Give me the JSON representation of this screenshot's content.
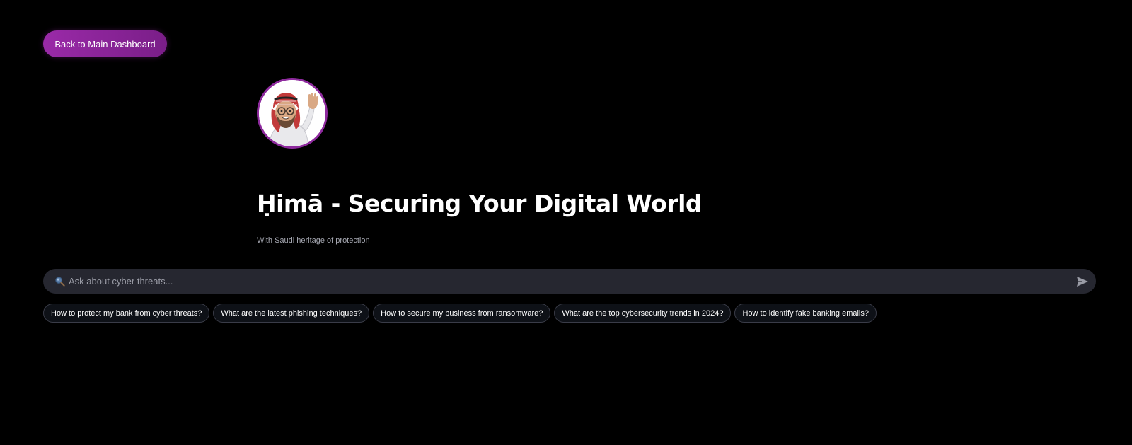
{
  "nav": {
    "back_label": "Back to Main Dashboard"
  },
  "header": {
    "avatar_icon": "waving-man-avatar-icon",
    "title": "Ḥimā - Securing Your Digital World",
    "subtitle": "With Saudi heritage of protection"
  },
  "chat": {
    "placeholder": "Ask about cyber threats...",
    "value": "",
    "search_icon": "search-icon",
    "send_icon": "send-icon"
  },
  "suggestions": [
    {
      "label": "How to protect my bank from cyber threats?"
    },
    {
      "label": "What are the latest phishing techniques?"
    },
    {
      "label": "How to secure my business from ransomware?"
    },
    {
      "label": "What are the top cybersecurity trends in 2024?"
    },
    {
      "label": "How to identify fake banking emails?"
    }
  ],
  "colors": {
    "background": "#000000",
    "accent": "#9a2aa8",
    "input_bg": "#262730",
    "chip_border": "#3a3c48"
  }
}
